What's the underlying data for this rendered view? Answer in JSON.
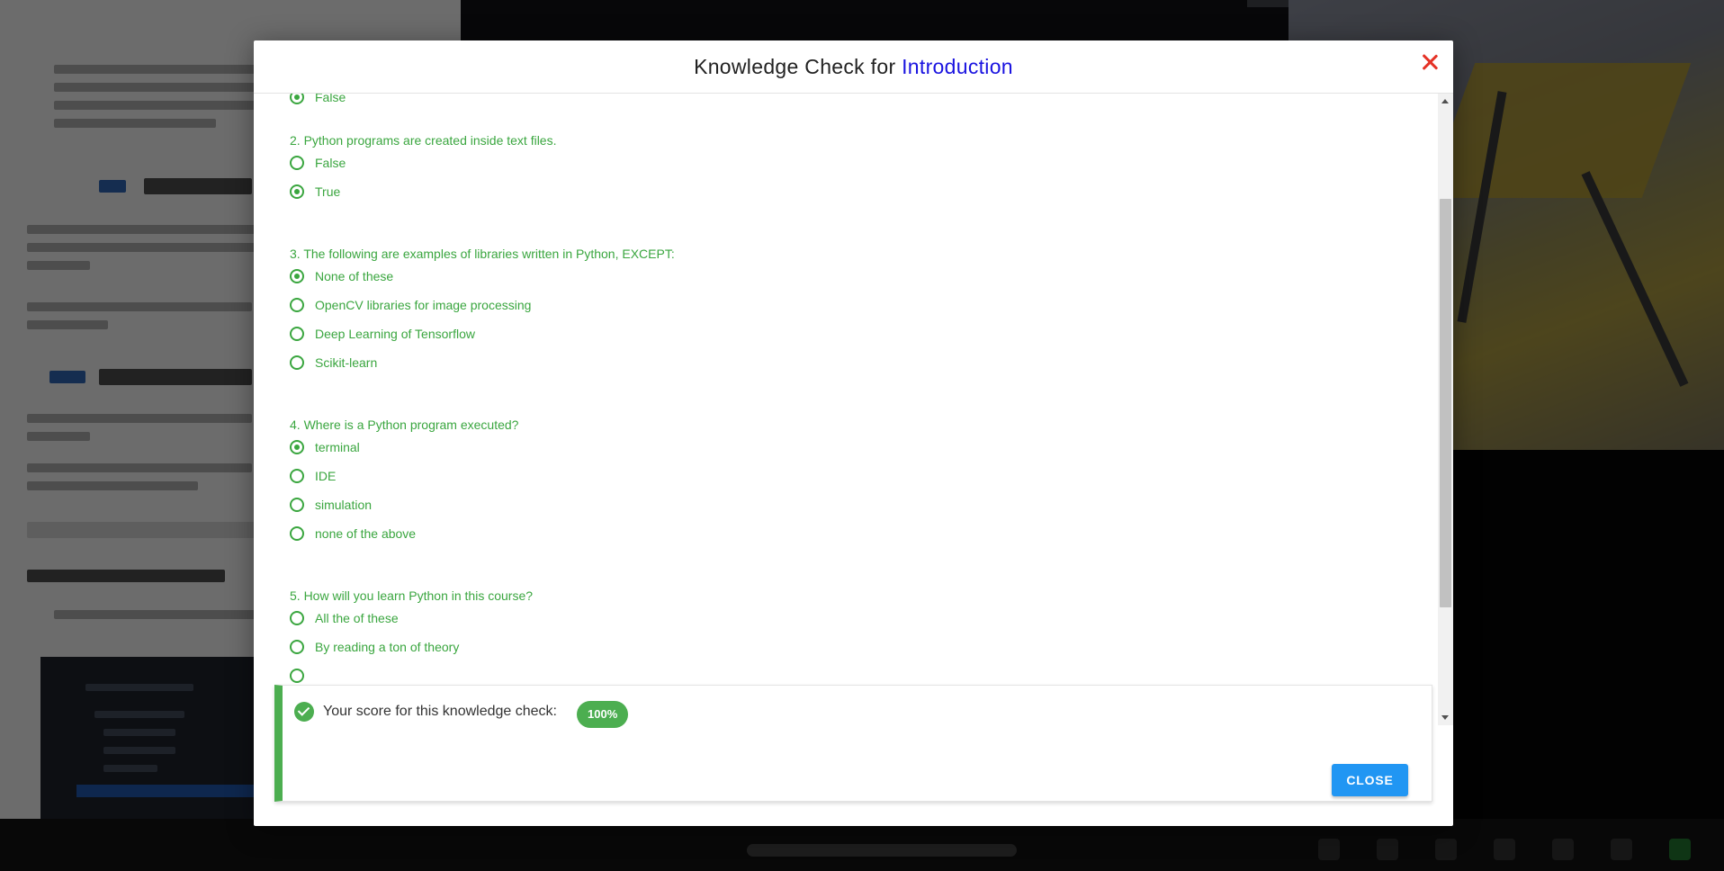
{
  "modal": {
    "title_prefix": "Knowledge Check for",
    "title_topic": "Introduction",
    "close_icon": "close-icon"
  },
  "quiz": {
    "q1_tail_option": {
      "label": "False",
      "checked": true
    },
    "questions": [
      {
        "text": "2. Python programs are created inside text files.",
        "options": [
          {
            "label": "False",
            "checked": false
          },
          {
            "label": "True",
            "checked": true
          }
        ]
      },
      {
        "text": "3. The following are examples of libraries written in Python, EXCEPT:",
        "options": [
          {
            "label": "None of these",
            "checked": true
          },
          {
            "label": "OpenCV libraries for image processing",
            "checked": false
          },
          {
            "label": "Deep Learning of Tensorflow",
            "checked": false
          },
          {
            "label": "Scikit-learn",
            "checked": false
          }
        ]
      },
      {
        "text": "4. Where is a Python program executed?",
        "options": [
          {
            "label": "terminal",
            "checked": true
          },
          {
            "label": "IDE",
            "checked": false
          },
          {
            "label": "simulation",
            "checked": false
          },
          {
            "label": "none of the above",
            "checked": false
          }
        ]
      },
      {
        "text": "5. How will you learn Python in this course?",
        "options": [
          {
            "label": "All the of these",
            "checked": false
          },
          {
            "label": "By reading a ton of theory",
            "checked": false
          }
        ]
      }
    ]
  },
  "result": {
    "score_label": "Your score for this knowledge check:",
    "score_value": "100%",
    "close_label": "CLOSE",
    "icon": "check-circle-icon"
  },
  "colors": {
    "accent_green": "#3aa63f",
    "topic_blue": "#1a13e0",
    "close_red": "#e53226",
    "button_blue": "#2196f3"
  }
}
